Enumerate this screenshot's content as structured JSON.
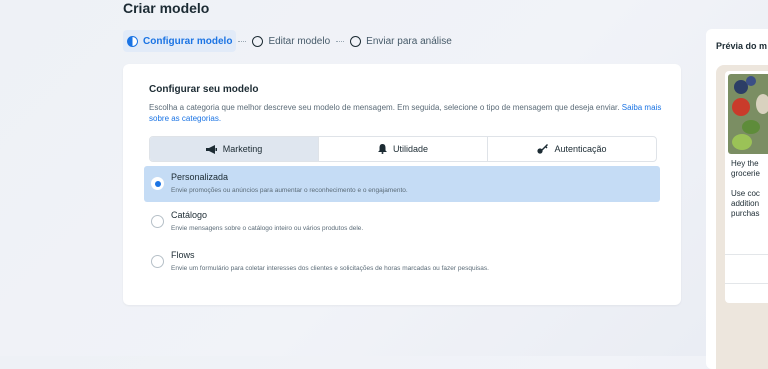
{
  "page": {
    "title": "Criar modelo"
  },
  "stepper": {
    "steps": [
      {
        "label": "Configurar modelo",
        "active": true
      },
      {
        "label": "Editar modelo",
        "active": false
      },
      {
        "label": "Enviar para análise",
        "active": false
      }
    ]
  },
  "config": {
    "heading": "Configurar seu modelo",
    "description": "Escolha a categoria que melhor descreve seu modelo de mensagem. Em seguida, selecione o tipo de mensagem que deseja enviar.",
    "link": "Saiba mais sobre as categorias.",
    "tabs": [
      {
        "label": "Marketing",
        "icon": "megaphone-icon",
        "selected": true
      },
      {
        "label": "Utilidade",
        "icon": "bell-icon",
        "selected": false
      },
      {
        "label": "Autenticação",
        "icon": "key-icon",
        "selected": false
      }
    ],
    "options": [
      {
        "title": "Personalizada",
        "description": "Envie promoções ou anúncios para aumentar o reconhecimento e o engajamento.",
        "selected": true
      },
      {
        "title": "Catálogo",
        "description": "Envie mensagens sobre o catálogo inteiro ou vários produtos dele.",
        "selected": false
      },
      {
        "title": "Flows",
        "description": "Envie um formulário para coletar interesses dos clientes e solicitações de horas marcadas ou fazer pesquisas.",
        "selected": false
      }
    ]
  },
  "preview": {
    "title": "Prévia do m",
    "message_lines": [
      "Hey the",
      "grocerie",
      "",
      "Use coc",
      "addition",
      "purchas"
    ]
  },
  "colors": {
    "accent": "#1b74e4",
    "selected_bg": "#c5dcf5",
    "tab_selected_bg": "#dfe6ef"
  }
}
